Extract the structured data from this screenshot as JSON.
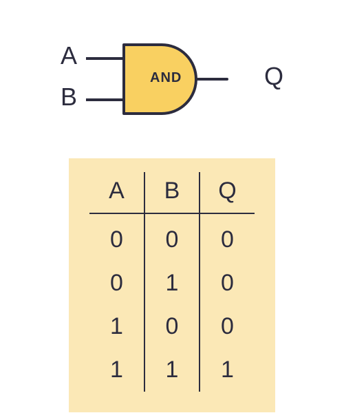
{
  "gate": {
    "type": "AND",
    "inputs": [
      "A",
      "B"
    ],
    "output": "Q",
    "fill": "#f9d061",
    "stroke": "#2c2c3e"
  },
  "truth_table": {
    "headers": [
      "A",
      "B",
      "Q"
    ],
    "rows": [
      [
        "0",
        "0",
        "0"
      ],
      [
        "0",
        "1",
        "0"
      ],
      [
        "1",
        "0",
        "0"
      ],
      [
        "1",
        "1",
        "1"
      ]
    ]
  },
  "colors": {
    "table_bg": "#fbe8b6",
    "text": "#2c2c3e"
  }
}
